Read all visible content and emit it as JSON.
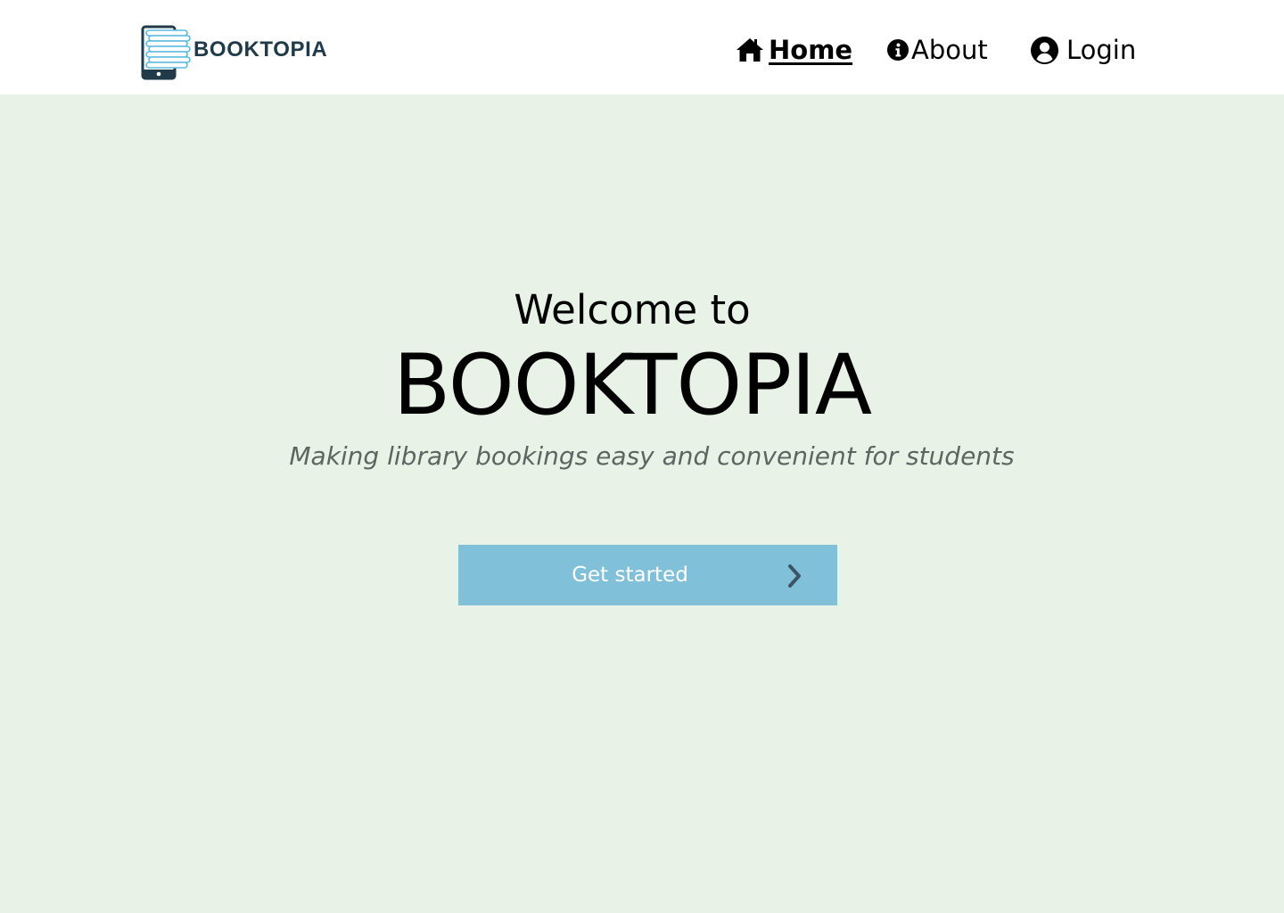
{
  "header": {
    "logo_text": "BOOKTOPIA",
    "nav": {
      "home": {
        "label": "Home",
        "icon": "home-icon",
        "active": true
      },
      "about": {
        "label": "About",
        "icon": "info-circle-icon"
      },
      "login": {
        "label": "Login",
        "icon": "user-circle-icon"
      }
    }
  },
  "hero": {
    "welcome": "Welcome to",
    "title": "BOOKTOPIA",
    "tagline": "Making library bookings easy and convenient for students",
    "cta_label": "Get started",
    "cta_icon": "chevron-right-icon"
  },
  "colors": {
    "page_background": "#e8f2e7",
    "header_background": "#ffffff",
    "cta_background": "#80c0d8",
    "logo_text": "#203a4a",
    "logo_accent": "#5bbbe0",
    "tagline": "#5c6660"
  }
}
